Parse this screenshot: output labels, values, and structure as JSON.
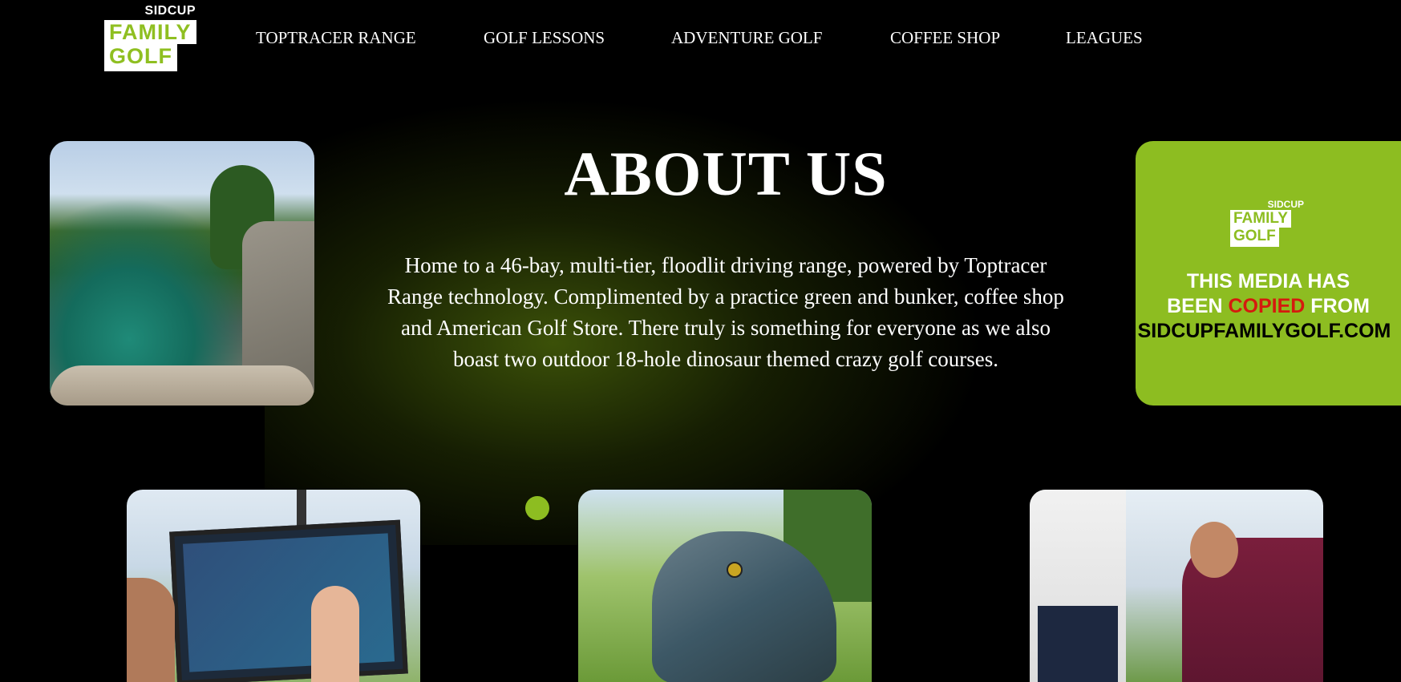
{
  "header": {
    "logo": {
      "top": "SIDCUP",
      "line1": "FAMILY",
      "line2": "GOLF"
    },
    "nav": [
      {
        "label": "TOPTRACER RANGE"
      },
      {
        "label": "GOLF LESSONS"
      },
      {
        "label": "ADVENTURE GOLF"
      },
      {
        "label": "COFFEE SHOP"
      },
      {
        "label": "LEAGUES"
      }
    ]
  },
  "about": {
    "title": "ABOUT US",
    "description": "Home to a 46-bay, multi-tier, floodlit driving range, powered by Toptracer Range technology. Complimented by a practice green and bunker, coffee shop and American Golf Store. There truly is something for everyone as we also boast two outdoor 18-hole dinosaur themed crazy golf courses."
  },
  "promo": {
    "logo": {
      "top": "SIDCUP",
      "line1": "FAMILY",
      "line2": "GOLF"
    },
    "line1": "THIS MEDIA HAS",
    "line2a": "BEEN ",
    "line2b": "COPIED",
    "line2c": " FROM",
    "line3": "SIDCUPFAMILYGOLF.COM"
  },
  "colors": {
    "accent": "#8dbd21",
    "background": "#000000",
    "warning": "#d51a0e"
  }
}
